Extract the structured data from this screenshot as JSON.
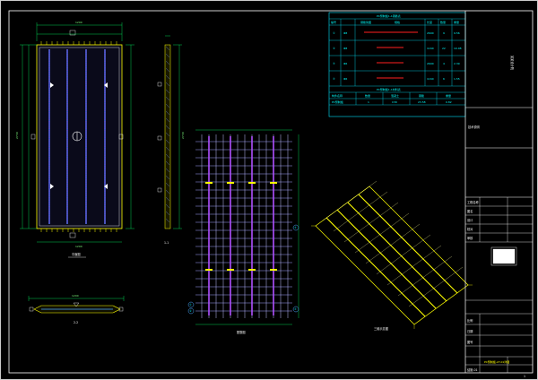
{
  "colors": {
    "background": "#000000",
    "frame": "#ffffff",
    "dimension": "#00ff66",
    "rebar_yellow": "#ffff00",
    "rebar_blue": "#4da6ff",
    "rebar_purple": "#b060ff",
    "table_cyan": "#00e5ff",
    "highlight_red": "#ff2020"
  },
  "plan_view": {
    "caption": "平面图",
    "dim_left": "2730",
    "dim_top": "1200",
    "dim_bottom": "1200",
    "section_marks": [
      "1",
      "1"
    ],
    "lift_point_label": "吊点"
  },
  "side_view": {
    "caption": "1-1",
    "dim_right": "2730"
  },
  "end_section": {
    "caption": "2-2",
    "dim": "1200"
  },
  "rebar_plan": {
    "caption": "配筋图",
    "bubble_labels": [
      "①",
      "②",
      "③",
      "④"
    ]
  },
  "iso_view": {
    "caption": "三维示意图"
  },
  "material_table": {
    "title": "PC预制板1-1钢筋表",
    "headers": [
      "编号",
      "钢筋简图",
      "规格",
      "长度",
      "数量",
      "重量"
    ],
    "rows": [
      {
        "id": "①",
        "spec": "Φ8",
        "len": "2690",
        "qty": "9",
        "wt": "9.56"
      },
      {
        "id": "②",
        "spec": "Φ8",
        "len": "1160",
        "qty": "22",
        "wt": "10.08"
      },
      {
        "id": "③",
        "spec": "Φ6",
        "len": "2690",
        "qty": "4",
        "wt": "2.39"
      },
      {
        "id": "④",
        "spec": "Φ6",
        "len": "1160",
        "qty": "6",
        "wt": "1.55"
      }
    ],
    "summary_title": "PC预制板1-1材料表",
    "summary_headers": [
      "构件名称",
      "数量",
      "混凝土",
      "钢筋",
      "重量"
    ],
    "summary_row": [
      "PC预制板",
      "1",
      "C30",
      "23.58",
      "0.82"
    ],
    "note_heading": "技术说明"
  },
  "title_block": {
    "company": "某某设计院",
    "project_label": "工程名称",
    "drawing_label": "图名",
    "design_label": "设计",
    "check_label": "校对",
    "approve_label": "审核",
    "scale_label": "比例",
    "date_label": "日期",
    "sheet_label": "图号",
    "drawing_title": "PC预制板-LF-01详图",
    "sheet_number": "结施-01",
    "page": "1"
  }
}
